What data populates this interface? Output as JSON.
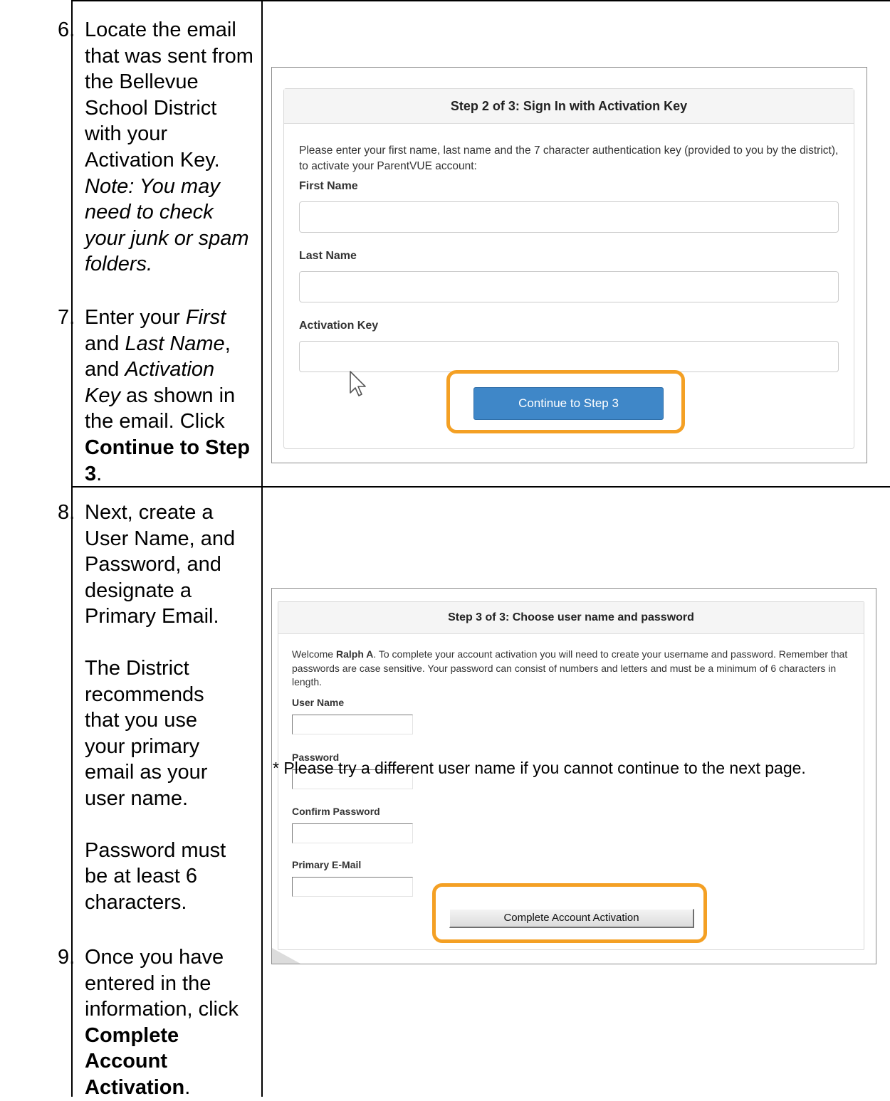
{
  "step6": {
    "number": "6.",
    "text": "Locate the email that was sent from the Bellevue School District with your Activation Key.",
    "note_prefix": "Note: You",
    "note_rest": "may need to check your junk or spam folders."
  },
  "step7": {
    "number": "7.",
    "t1": "Enter your ",
    "first": "First",
    "t2": " and ",
    "last": "Last Name",
    "t3": ", and ",
    "key": "Activation Key",
    "t4": " as shown in the email. Click ",
    "action": "Continue to Step 3",
    "t5": "."
  },
  "step8": {
    "number": "8.",
    "text": "Next, create a User Name, and Password, and designate a Primary Email.",
    "para2": "The District recommends that you use your primary email as your user name.",
    "para3": "Password must be at least 6 characters."
  },
  "step9": {
    "number": "9.",
    "t1": "Once you have entered in the information, click ",
    "action": "Complete Account Activation",
    "t2": "."
  },
  "activation_form": {
    "title": "Step 2 of 3: Sign In with Activation Key",
    "description": "Please enter your first name, last name and the 7 character authentication key (provided to you by the district), to activate your ParentVUE account:",
    "first_name_label": "First Name",
    "last_name_label": "Last Name",
    "activation_key_label": "Activation Key",
    "first_name_value": "",
    "last_name_value": "",
    "activation_key_value": "",
    "continue_button": "Continue to Step 3"
  },
  "credentials_form": {
    "title": "Step 3 of 3: Choose user name and password",
    "welcome_prefix": "Welcome ",
    "user": "Ralph A",
    "welcome_rest": ". To complete your account activation you will need to create your username and password. Remember that passwords are case sensitive. Your password can consist of numbers and letters and must be a minimum of 6 characters in length.",
    "user_name_label": "User Name",
    "password_label": "Password",
    "confirm_password_label": "Confirm Password",
    "primary_email_label": "Primary E-Mail",
    "user_name_value": "",
    "password_value": "",
    "confirm_password_value": "",
    "primary_email_value": "",
    "complete_button": "Complete Account Activation"
  },
  "footnote": "* Please try a different user name if you cannot continue to the next page.",
  "colors": {
    "highlight": "#f4a024",
    "primary_button": "#3f87c8"
  }
}
